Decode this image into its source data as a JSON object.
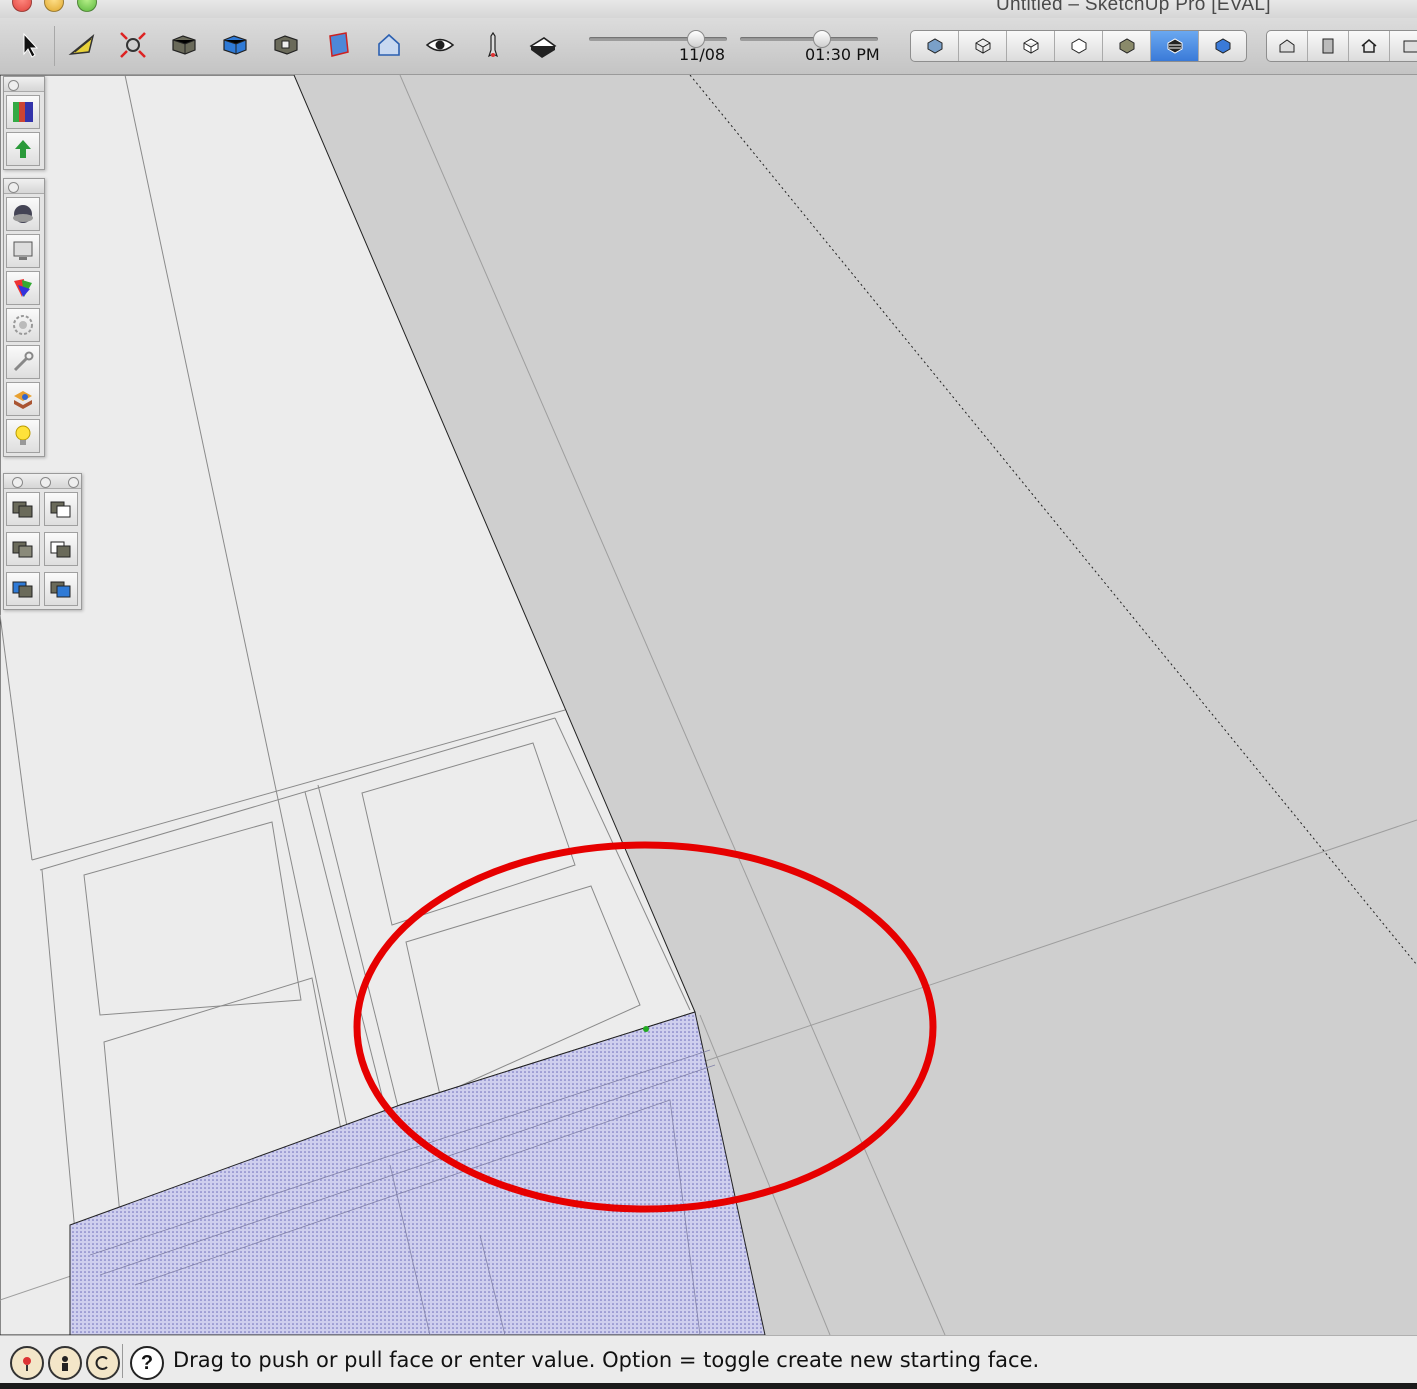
{
  "window": {
    "title": "Untitled – SketchUp Pro [EVAL]"
  },
  "toolbar": {
    "tools": [
      "select-tool",
      "tape-measure-tool",
      "zoom-extents-tool",
      "previous-view-tool",
      "next-view-tool",
      "standard-views-tool",
      "section-plane-tool",
      "parallel-projection-tool",
      "look-around-tool",
      "walk-tool",
      "push-pull-tool"
    ],
    "shadow_date": "11/08",
    "shadow_time": "01:30 PM",
    "shadow_date_fraction": 0.8,
    "shadow_time_fraction": 0.6,
    "face_styles": [
      "xray",
      "wireframe",
      "hidden-line",
      "shaded",
      "shaded-with-textures",
      "monochrome",
      "back-edges"
    ],
    "active_face_style": 5,
    "view_tools": [
      "iso-view",
      "top-view",
      "front-view",
      "right-view"
    ]
  },
  "palettes": {
    "left_top": [
      "colors",
      "up-arrow"
    ],
    "left_middle": [
      "materials",
      "components",
      "styles",
      "settings",
      "entity-info",
      "layers",
      "tips"
    ],
    "left_bottom": [
      "union",
      "subtract",
      "intersect",
      "trim",
      "split",
      "outer-shell"
    ]
  },
  "status": {
    "icons": [
      "geo-location-icon",
      "credits-icon",
      "license-icon"
    ],
    "help_icon": "help-icon",
    "message": "Drag to push or pull face or enter value.  Option = toggle create new starting face."
  },
  "colors": {
    "annotation": "#e60000",
    "selection_fill": "#c9c9ee",
    "face_light": "#ececec",
    "ground": "#cfcfcf"
  }
}
